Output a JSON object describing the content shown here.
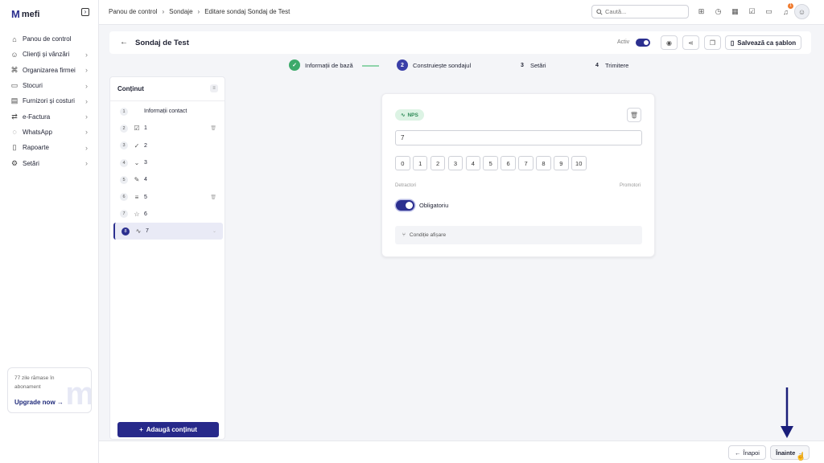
{
  "app": {
    "logo_mark": "M",
    "logo_text": "mefi"
  },
  "sidebar": {
    "items": [
      {
        "label": "Panou de control",
        "icon": "home-icon",
        "chevron": false
      },
      {
        "label": "Clienți și vânzări",
        "icon": "users-icon",
        "chevron": true
      },
      {
        "label": "Organizarea firmei",
        "icon": "org-icon",
        "chevron": true
      },
      {
        "label": "Stocuri",
        "icon": "box-icon",
        "chevron": true
      },
      {
        "label": "Furnizori și costuri",
        "icon": "truck-icon",
        "chevron": true
      },
      {
        "label": "e-Factura",
        "icon": "invoice-icon",
        "chevron": true
      },
      {
        "label": "WhatsApp",
        "icon": "whatsapp-icon",
        "chevron": true
      },
      {
        "label": "Rapoarte",
        "icon": "report-icon",
        "chevron": true
      },
      {
        "label": "Setări",
        "icon": "gear-icon",
        "chevron": true
      }
    ],
    "upgrade": {
      "text": "77 zile rămase în abonament",
      "link": "Upgrade now"
    }
  },
  "topbar": {
    "breadcrumbs": [
      "Panou de control",
      "Sondaje",
      "Editare sondaj Sondaj de Test"
    ],
    "search_placeholder": "Caută...",
    "notification_count": "1"
  },
  "header": {
    "title": "Sondaj de Test",
    "active_label": "Activ",
    "save_template": "Salvează ca șablon"
  },
  "stepper": {
    "steps": [
      {
        "number": "✓",
        "label": "Informații de bază",
        "state": "done"
      },
      {
        "number": "2",
        "label": "Construiește sondajul",
        "state": "active"
      },
      {
        "number": "3",
        "label": "Setări",
        "state": "pending"
      },
      {
        "number": "4",
        "label": "Trimitere",
        "state": "pending"
      }
    ]
  },
  "content_panel": {
    "title": "Conținut",
    "items": [
      {
        "num": "1",
        "icon": "",
        "label": "Informații contact",
        "trash": false,
        "active": false
      },
      {
        "num": "2",
        "icon": "☑",
        "label": "1",
        "trash": true,
        "active": false
      },
      {
        "num": "3",
        "icon": "✓",
        "label": "2",
        "trash": false,
        "active": false
      },
      {
        "num": "4",
        "icon": "⌄",
        "label": "3",
        "trash": false,
        "active": false
      },
      {
        "num": "5",
        "icon": "✎",
        "label": "4",
        "trash": false,
        "active": false
      },
      {
        "num": "6",
        "icon": "≡",
        "label": "5",
        "trash": true,
        "active": false
      },
      {
        "num": "7",
        "icon": "☆",
        "label": "6",
        "trash": false,
        "active": false
      },
      {
        "num": "8",
        "icon": "∿",
        "label": "7",
        "trash": true,
        "active": true
      }
    ],
    "add_button": "Adaugă conținut"
  },
  "editor": {
    "type_badge": "NPS",
    "question_value": "7",
    "scale": [
      "0",
      "1",
      "2",
      "3",
      "4",
      "5",
      "6",
      "7",
      "8",
      "9",
      "10"
    ],
    "left_label": "Detractori",
    "right_label": "Promotori",
    "required_label": "Obligatoriu",
    "required": true,
    "condition_label": "Condiție afișare"
  },
  "footer": {
    "back": "Înapoi",
    "next": "Înainte"
  },
  "colors": {
    "primary": "#2b2f8f",
    "success": "#3daa6a",
    "nps_bg": "#dcf3e4",
    "badge": "#f07a2d"
  }
}
